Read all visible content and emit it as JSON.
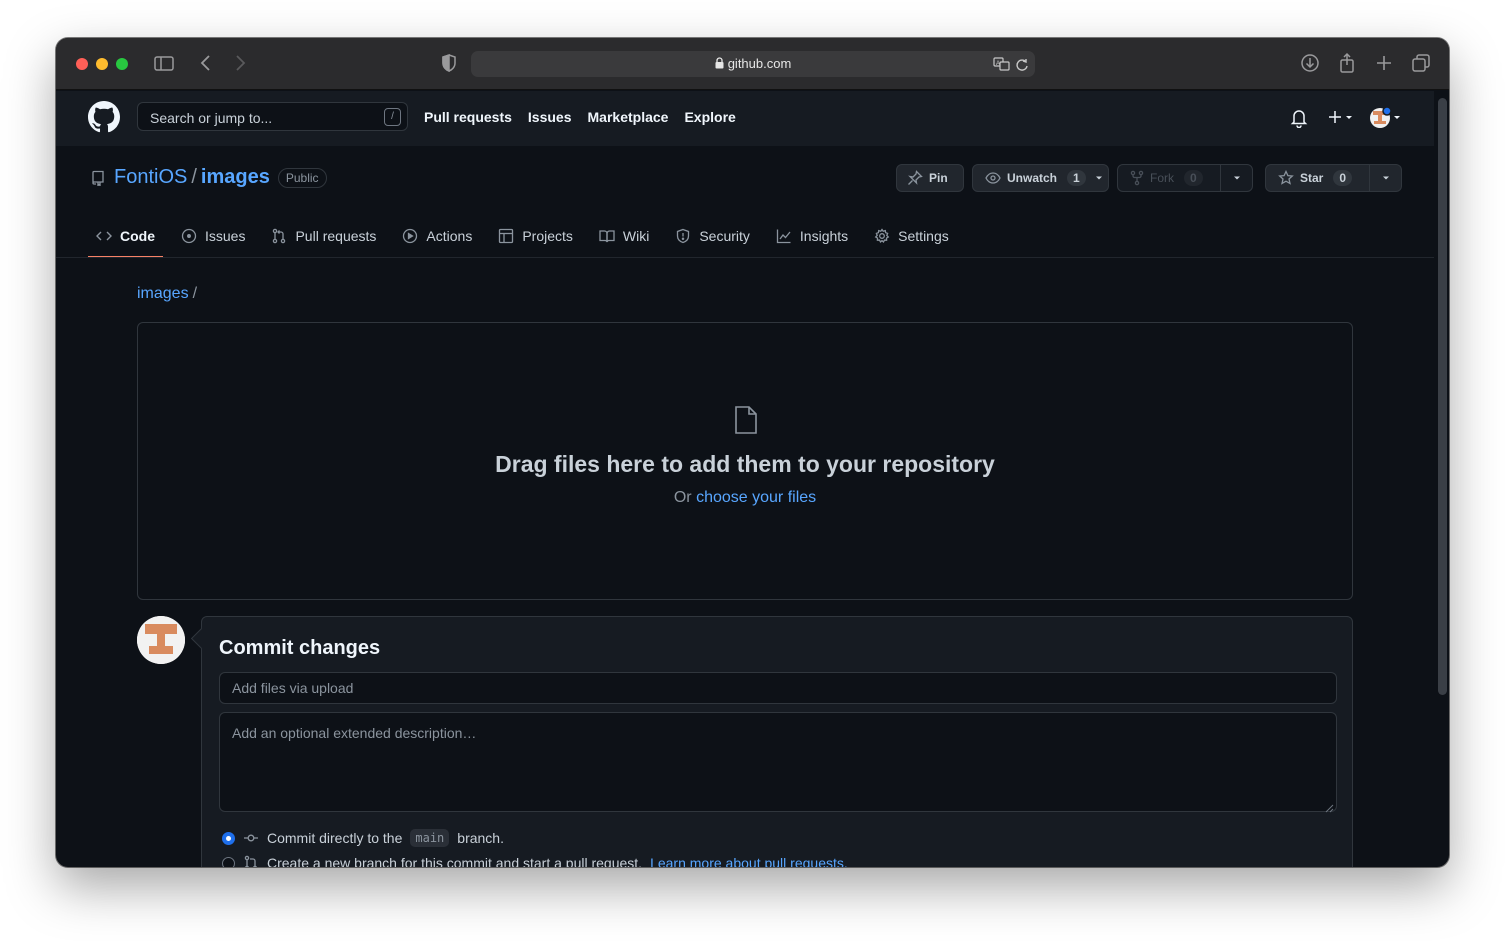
{
  "browser": {
    "url": "github.com"
  },
  "header": {
    "search_placeholder": "Search or jump to...",
    "search_shortcut": "/",
    "nav": [
      "Pull requests",
      "Issues",
      "Marketplace",
      "Explore"
    ]
  },
  "repo": {
    "owner": "FontiOS",
    "separator": "/",
    "name": "images",
    "visibility": "Public",
    "pin_label": "Pin",
    "unwatch_label": "Unwatch",
    "unwatch_count": "1",
    "fork_label": "Fork",
    "fork_count": "0",
    "star_label": "Star",
    "star_count": "0"
  },
  "tabs": [
    {
      "label": "Code",
      "icon": "code-icon"
    },
    {
      "label": "Issues",
      "icon": "issue-icon"
    },
    {
      "label": "Pull requests",
      "icon": "pull-request-icon"
    },
    {
      "label": "Actions",
      "icon": "play-icon"
    },
    {
      "label": "Projects",
      "icon": "table-icon"
    },
    {
      "label": "Wiki",
      "icon": "book-icon"
    },
    {
      "label": "Security",
      "icon": "shield-icon"
    },
    {
      "label": "Insights",
      "icon": "graph-icon"
    },
    {
      "label": "Settings",
      "icon": "gear-icon"
    }
  ],
  "breadcrumb": {
    "link": "images",
    "slash": "/"
  },
  "dropzone": {
    "title": "Drag files here to add them to your repository",
    "prefix": "Or",
    "link": "choose your files"
  },
  "commit": {
    "title": "Commit changes",
    "summary_placeholder": "Add files via upload",
    "description_placeholder": "Add an optional extended description…",
    "option_direct_prefix": "Commit directly to the",
    "option_direct_branch": "main",
    "option_direct_suffix": "branch.",
    "option_new_text": "Create a new branch for this commit and start a pull request.",
    "option_new_link": "Learn more about pull requests."
  },
  "colors": {
    "background": "#0d1117",
    "header": "#161b22",
    "link": "#58a6ff",
    "active_tab_underline": "#f78166"
  }
}
